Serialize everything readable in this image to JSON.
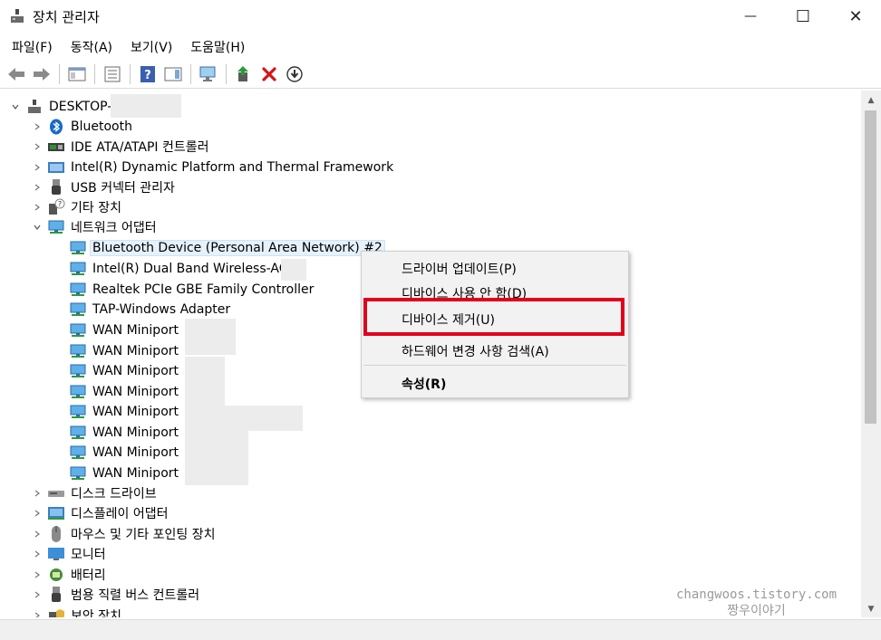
{
  "window": {
    "title": "장치 관리자",
    "minimize": "—",
    "maximize": "☐",
    "close": "✕"
  },
  "menu": [
    {
      "label": "파일(F)"
    },
    {
      "label": "동작(A)"
    },
    {
      "label": "보기(V)"
    },
    {
      "label": "도움말(H)"
    }
  ],
  "toolbar": {
    "icons": [
      "back-arrow-icon",
      "forward-arrow-icon",
      "properties-window-icon",
      "list-view-icon",
      "help-icon",
      "action-pane-icon",
      "scan-monitor-icon",
      "update-driver-icon",
      "uninstall-x-icon",
      "download-icon"
    ]
  },
  "tree": {
    "root": "DESKTOP-",
    "categories": [
      {
        "label": "Bluetooth",
        "icon": "bluetooth-icon"
      },
      {
        "label": "IDE ATA/ATAPI 컨트롤러",
        "icon": "ide-controller-icon"
      },
      {
        "label": "Intel(R) Dynamic Platform and Thermal Framework",
        "icon": "platform-device-icon"
      },
      {
        "label": "USB 커넥터 관리자",
        "icon": "usb-icon"
      },
      {
        "label": "기타 장치",
        "icon": "unknown-device-icon"
      },
      {
        "label": "네트워크 어댑터",
        "icon": "network-adapter-icon"
      }
    ],
    "adapters": [
      "Bluetooth Device (Personal Area Network) #2",
      "Intel(R) Dual Band Wireless-AC",
      "Realtek PCIe GBE Family Controller",
      "TAP-Windows Adapter",
      "WAN Miniport",
      "WAN Miniport",
      "WAN Miniport",
      "WAN Miniport",
      "WAN Miniport",
      "WAN Miniport",
      "WAN Miniport",
      "WAN Miniport"
    ],
    "more_categories": [
      {
        "label": "디스크 드라이브",
        "icon": "disk-drive-icon"
      },
      {
        "label": "디스플레이 어댑터",
        "icon": "display-adapter-icon"
      },
      {
        "label": "마우스 및 기타 포인팅 장치",
        "icon": "mouse-icon"
      },
      {
        "label": "모니터",
        "icon": "monitor-icon"
      },
      {
        "label": "배터리",
        "icon": "battery-icon"
      },
      {
        "label": "범용 직렬 버스 컨트롤러",
        "icon": "usb-controller-icon"
      },
      {
        "label": "보안 장치",
        "icon": "security-device-icon"
      }
    ]
  },
  "context_menu": {
    "items": [
      "드라이버 업데이트(P)",
      "디바이스 사용 안 함(D)",
      "디바이스 제거(U)",
      "하드웨어 변경 사항 검색(A)",
      "속성(R)"
    ],
    "highlight_color": "#e3001b"
  },
  "watermark": {
    "line1": "changwoos.tistory.com",
    "line2": "짱우이야기"
  }
}
